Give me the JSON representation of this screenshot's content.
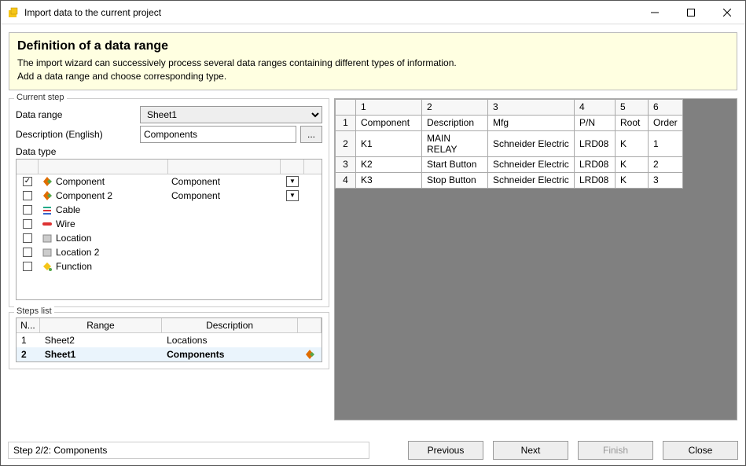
{
  "window": {
    "title": "Import data to the current project"
  },
  "banner": {
    "heading": "Definition of a data range",
    "line1": "The import wizard can successively process several data ranges containing different types of information.",
    "line2": "Add a data range and choose corresponding type."
  },
  "current_step": {
    "legend": "Current step",
    "range_label": "Data range",
    "range_value": "Sheet1",
    "desc_label": "Description (English)",
    "desc_value": "Components",
    "dots": "...",
    "type_label": "Data type",
    "types": [
      {
        "checked": true,
        "name": "Component",
        "map": "Component",
        "dd": true,
        "icon": "comp"
      },
      {
        "checked": false,
        "name": "Component 2",
        "map": "Component",
        "dd": true,
        "icon": "comp"
      },
      {
        "checked": false,
        "name": "Cable",
        "map": "",
        "dd": false,
        "icon": "cable"
      },
      {
        "checked": false,
        "name": "Wire",
        "map": "",
        "dd": false,
        "icon": "wire"
      },
      {
        "checked": false,
        "name": "Location",
        "map": "",
        "dd": false,
        "icon": "loc"
      },
      {
        "checked": false,
        "name": "Location 2",
        "map": "",
        "dd": false,
        "icon": "loc"
      },
      {
        "checked": false,
        "name": "Function",
        "map": "",
        "dd": false,
        "icon": "func"
      }
    ]
  },
  "steps_list": {
    "legend": "Steps list",
    "hdr": {
      "n": "N...",
      "range": "Range",
      "desc": "Description"
    },
    "rows": [
      {
        "n": "1",
        "range": "Sheet2",
        "desc": "Locations",
        "selected": false,
        "icon": false
      },
      {
        "n": "2",
        "range": "Sheet1",
        "desc": "Components",
        "selected": true,
        "icon": true
      }
    ]
  },
  "preview": {
    "columns": [
      "1",
      "2",
      "3",
      "4",
      "5",
      "6"
    ],
    "rows": [
      {
        "n": "1",
        "cells": [
          "Component",
          "Description",
          "Mfg",
          "P/N",
          "Root",
          "Order"
        ]
      },
      {
        "n": "2",
        "cells": [
          "K1",
          "MAIN RELAY",
          "Schneider Electric",
          "LRD08",
          "K",
          "1"
        ]
      },
      {
        "n": "3",
        "cells": [
          "K2",
          "Start Button",
          "Schneider Electric",
          "LRD08",
          "K",
          "2"
        ]
      },
      {
        "n": "4",
        "cells": [
          "K3",
          "Stop Button",
          "Schneider Electric",
          "LRD08",
          "K",
          "3"
        ]
      }
    ]
  },
  "footer": {
    "status": "Step 2/2: Components",
    "previous": "Previous",
    "next": "Next",
    "finish": "Finish",
    "close": "Close"
  }
}
